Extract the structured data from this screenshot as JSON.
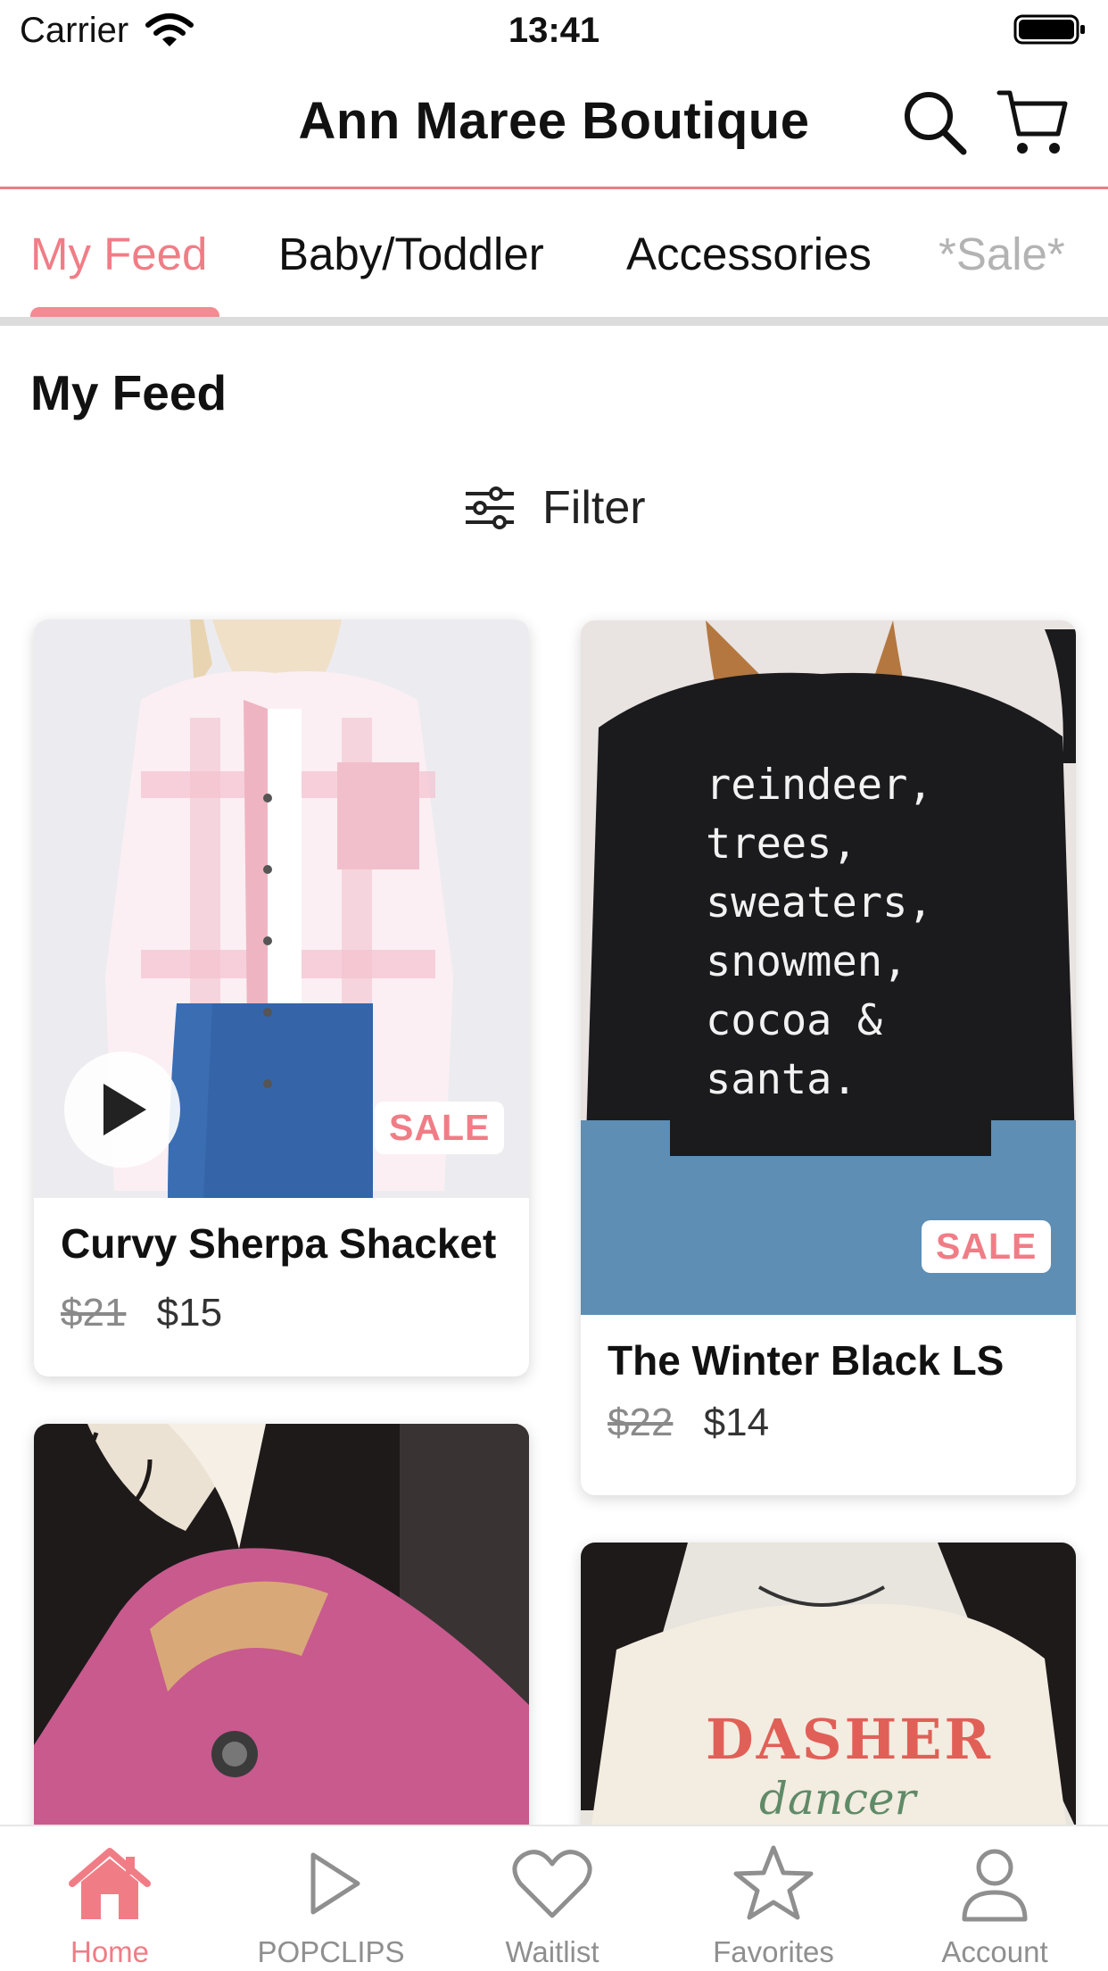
{
  "status_bar": {
    "carrier": "Carrier",
    "time": "13:41"
  },
  "header": {
    "title": "Ann Maree Boutique",
    "search_icon": "search-icon",
    "cart_icon": "cart-icon"
  },
  "tabs": [
    {
      "label": "My Feed",
      "active": true
    },
    {
      "label": "Baby/Toddler"
    },
    {
      "label": "Accessories"
    },
    {
      "label": "*Sale*"
    }
  ],
  "section_title": "My Feed",
  "filter": {
    "label": "Filter",
    "icon": "filter-icon"
  },
  "products": [
    {
      "name": "Curvy Sherpa Shacket",
      "old_price": "$21",
      "price": "$15",
      "badge": "SALE",
      "has_video": true
    },
    {
      "name": "The Winter Black LS",
      "old_price": "$22",
      "price": "$14",
      "badge": "SALE",
      "shirt_text": [
        "reindeer,",
        "trees,",
        "sweaters,",
        "snowmen,",
        "cocoa &",
        "santa."
      ]
    },
    {
      "name": "",
      "old_price": "",
      "price": ""
    },
    {
      "name": "",
      "old_price": "",
      "price": "",
      "shirt_text": [
        "DASHER",
        "dancer"
      ]
    }
  ],
  "nav": [
    {
      "label": "Home",
      "icon": "home-icon",
      "active": true
    },
    {
      "label": "POPCLIPS",
      "icon": "play-icon"
    },
    {
      "label": "Waitlist",
      "icon": "heart-icon"
    },
    {
      "label": "Favorites",
      "icon": "star-icon"
    },
    {
      "label": "Account",
      "icon": "person-icon"
    }
  ],
  "colors": {
    "accent": "#f07d86",
    "header_line": "#ec7d85",
    "tab_indicator": "#f28c92",
    "inactive": "#8f8f8f"
  }
}
